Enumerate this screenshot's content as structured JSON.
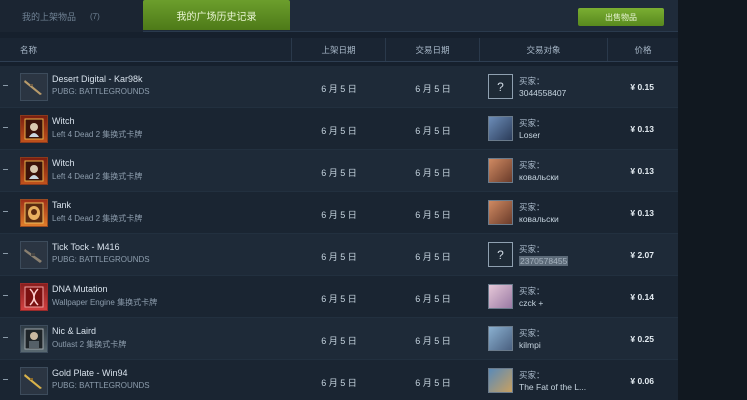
{
  "tabs": {
    "listed": {
      "label": "我的上架物品",
      "count": "(7)"
    },
    "history": {
      "label": "我的广场历史记录"
    }
  },
  "toolbar": {
    "sell_label": "出售物品"
  },
  "columns": {
    "name": "名称",
    "listed_date": "上架日期",
    "trade_date": "交易日期",
    "counterparty": "交易对象",
    "price": "价格"
  },
  "rows": [
    {
      "name": "Desert Digital - Kar98k",
      "game": "PUBG: BATTLEGROUNDS",
      "listed": "6 月 5 日",
      "traded": "6 月 5 日",
      "buyer_label": "买家：",
      "buyer": "3044558407",
      "price": "¥ 0.15",
      "thumb": "rifle-icon",
      "avatar": "question-avatar"
    },
    {
      "name": "Witch",
      "game": "Left 4 Dead 2 集换式卡牌",
      "listed": "6 月 5 日",
      "traded": "6 月 5 日",
      "buyer_label": "买家：",
      "buyer": "Loser",
      "price": "¥ 0.13",
      "thumb": "trading-card-icon",
      "avatar": "user-avatar"
    },
    {
      "name": "Witch",
      "game": "Left 4 Dead 2 集换式卡牌",
      "listed": "6 月 5 日",
      "traded": "6 月 5 日",
      "buyer_label": "买家：",
      "buyer": "ковальски",
      "price": "¥ 0.13",
      "thumb": "trading-card-icon",
      "avatar": "user-avatar"
    },
    {
      "name": "Tank",
      "game": "Left 4 Dead 2 集换式卡牌",
      "listed": "6 月 5 日",
      "traded": "6 月 5 日",
      "buyer_label": "买家：",
      "buyer": "ковальски",
      "price": "¥ 0.13",
      "thumb": "trading-card-icon",
      "avatar": "user-avatar"
    },
    {
      "name": "Tick Tock - M416",
      "game": "PUBG: BATTLEGROUNDS",
      "listed": "6 月 5 日",
      "traded": "6 月 5 日",
      "buyer_label": "买家：",
      "buyer": "2370578455",
      "price": "¥ 2.07",
      "thumb": "rifle-icon",
      "avatar": "question-avatar"
    },
    {
      "name": "DNA Mutation",
      "game": "Wallpaper Engine 集换式卡牌",
      "listed": "6 月 5 日",
      "traded": "6 月 5 日",
      "buyer_label": "买家：",
      "buyer": "czck +",
      "price": "¥ 0.14",
      "thumb": "trading-card-icon",
      "avatar": "user-avatar"
    },
    {
      "name": "Nic & Laird",
      "game": "Outlast 2 集换式卡牌",
      "listed": "6 月 5 日",
      "traded": "6 月 5 日",
      "buyer_label": "买家：",
      "buyer": "kilmpi",
      "price": "¥ 0.25",
      "thumb": "trading-card-icon",
      "avatar": "user-avatar"
    },
    {
      "name": "Gold Plate - Win94",
      "game": "PUBG: BATTLEGROUNDS",
      "listed": "6 月 5 日",
      "traded": "6 月 5 日",
      "buyer_label": "买家：",
      "buyer": "The Fat of the L...",
      "price": "¥ 0.06",
      "thumb": "rifle-icon",
      "avatar": "user-avatar"
    }
  ],
  "colors": {
    "background": "#1b2838",
    "active_tab": "#5e8c22",
    "sell_button": "#6a9e2a",
    "text": "#c6d4df"
  }
}
